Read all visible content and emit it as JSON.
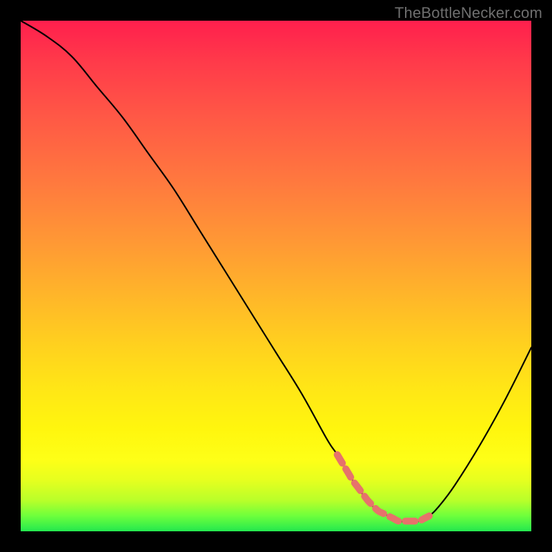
{
  "watermark": "TheBottleNecker.com",
  "colors": {
    "frame_background": "#000000",
    "gradient_top": "#ff1f4d",
    "gradient_mid": "#ffe616",
    "gradient_bottom": "#23e84f",
    "curve_stroke": "#000000",
    "highlight_stroke": "#e6736b"
  },
  "chart_data": {
    "type": "line",
    "title": "",
    "xlabel": "",
    "ylabel": "",
    "xlim": [
      0,
      100
    ],
    "ylim": [
      0,
      100
    ],
    "grid": false,
    "series": [
      {
        "name": "bottleneck-curve",
        "x": [
          0,
          5,
          10,
          15,
          20,
          25,
          30,
          35,
          40,
          45,
          50,
          55,
          60,
          62,
          65,
          68,
          70,
          72,
          74,
          76,
          78,
          80,
          82,
          85,
          90,
          95,
          100
        ],
        "values": [
          100,
          97,
          93,
          87,
          81,
          74,
          67,
          59,
          51,
          43,
          35,
          27,
          18,
          15,
          10,
          6,
          4,
          3,
          2,
          2,
          2,
          3,
          5,
          9,
          17,
          26,
          36
        ]
      }
    ],
    "annotations": [
      {
        "name": "optimal-range-highlight",
        "type": "segment",
        "style": "dashed",
        "x_start": 62,
        "x_end": 80,
        "y": 2
      }
    ]
  }
}
